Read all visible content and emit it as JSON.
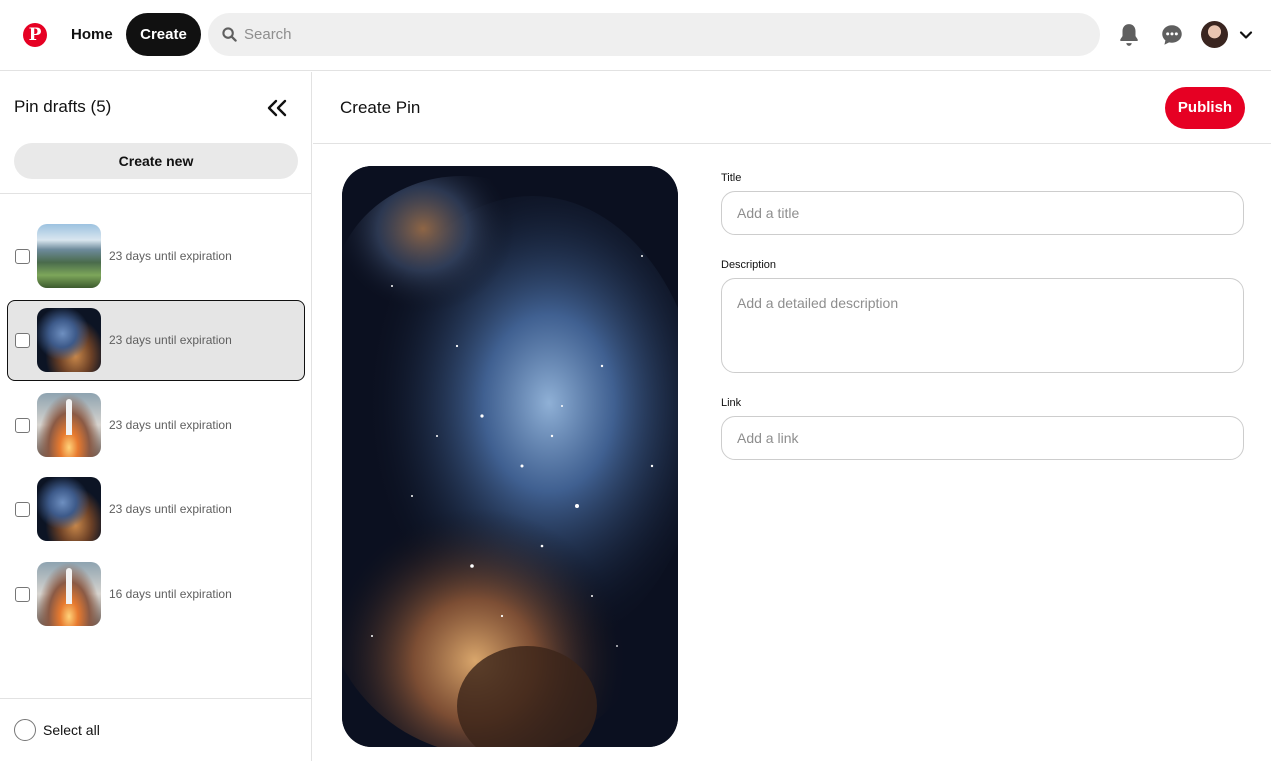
{
  "header": {
    "logo_letter": "P",
    "home_label": "Home",
    "create_label": "Create",
    "search_placeholder": "Search",
    "icons": [
      "pinterest-logo-icon",
      "search-icon",
      "bell-icon",
      "chat-bubble-icon",
      "chevron-down-icon"
    ],
    "brand_color": "#e60023"
  },
  "sidebar": {
    "title": "Pin drafts (5)",
    "create_new_label": "Create new",
    "drafts": [
      {
        "expiration": "23 days until expiration",
        "thumbnail": "mountain-landscape",
        "selected": false
      },
      {
        "expiration": "23 days until expiration",
        "thumbnail": "nebula",
        "selected": true
      },
      {
        "expiration": "23 days until expiration",
        "thumbnail": "rocket-launch",
        "selected": false
      },
      {
        "expiration": "23 days until expiration",
        "thumbnail": "nebula",
        "selected": false
      },
      {
        "expiration": "16 days until expiration",
        "thumbnail": "rocket-launch",
        "selected": false
      }
    ],
    "select_all_label": "Select all"
  },
  "main": {
    "title": "Create Pin",
    "publish_label": "Publish",
    "image": "nebula",
    "fields": {
      "title_label": "Title",
      "title_placeholder": "Add a title",
      "description_label": "Description",
      "description_placeholder": "Add a detailed description",
      "link_label": "Link",
      "link_placeholder": "Add a link"
    }
  }
}
